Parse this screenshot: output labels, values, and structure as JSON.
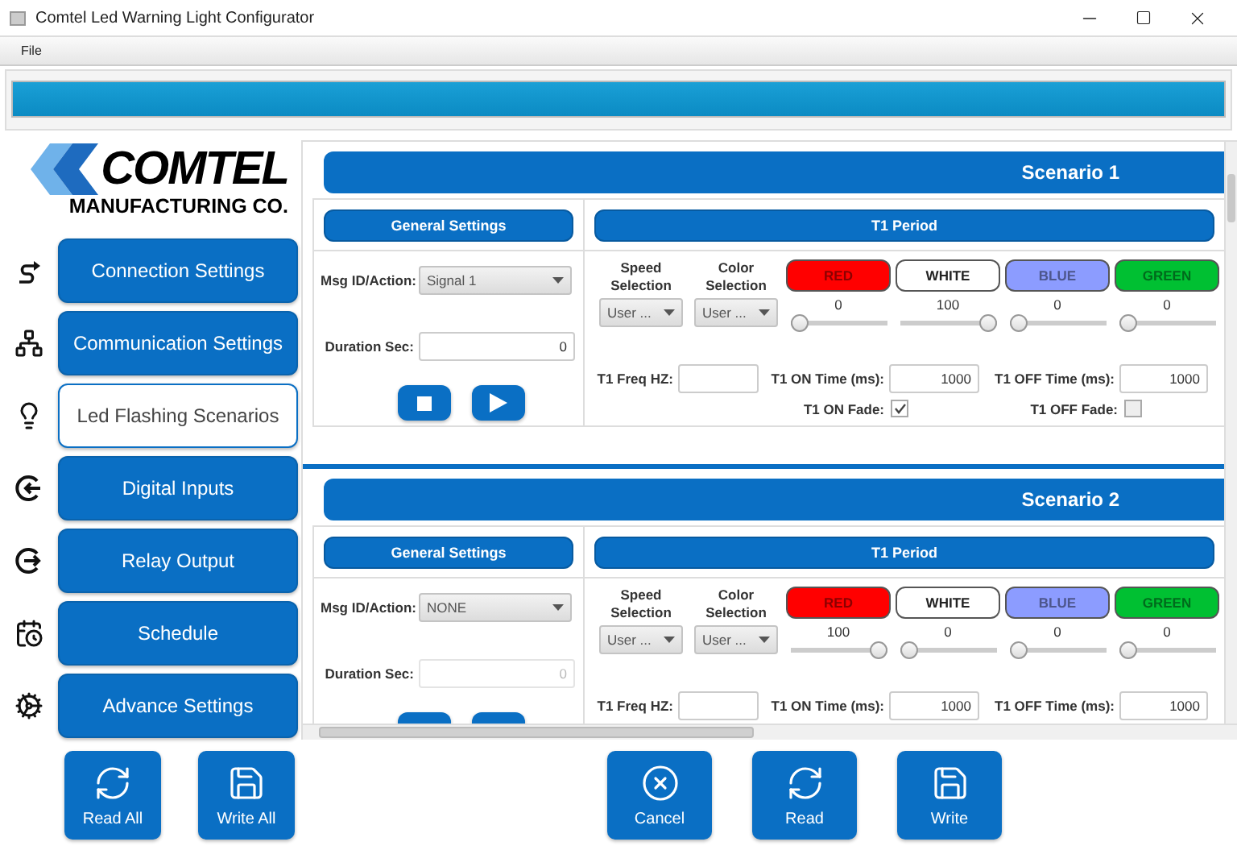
{
  "window": {
    "title": "Comtel Led Warning Light Configurator"
  },
  "menu": [
    "File"
  ],
  "progress": {
    "level": 1
  },
  "logo": {
    "name": "COMTEL",
    "tagline": "MANUFACTURING CO."
  },
  "sidebar": {
    "items": [
      {
        "label": "Connection Settings",
        "selected": false
      },
      {
        "label": "Communication Settings",
        "selected": false
      },
      {
        "label": "Led Flashing Scenarios",
        "selected": true
      },
      {
        "label": "Digital Inputs",
        "selected": false
      },
      {
        "label": "Relay Output",
        "selected": false
      },
      {
        "label": "Schedule",
        "selected": false
      },
      {
        "label": "Advance Settings",
        "selected": false
      }
    ]
  },
  "scenarios": [
    {
      "title": "Scenario 1",
      "general": {
        "header": "General Settings",
        "msg_label": "Msg ID/Action:",
        "msg_value": "Signal 1",
        "duration_label": "Duration Sec:",
        "duration_value": "0",
        "duration_disabled": false
      },
      "period": {
        "header": "T1 Period",
        "speed_label": "Speed Selection",
        "speed_value": "User ...",
        "color_label": "Color Selection",
        "color_value": "User ...",
        "channels": [
          {
            "label": "RED",
            "color": "#ff0000",
            "reading": "0",
            "level": 0
          },
          {
            "label": "WHITE",
            "color": "#ffffff",
            "reading": "100",
            "level": 1
          },
          {
            "label": "BLUE",
            "color": "#8c9cff",
            "reading": "0",
            "level": 0
          },
          {
            "label": "GREEN",
            "color": "#00c032",
            "reading": "0",
            "level": 0
          }
        ],
        "freq_label": "T1 Freq HZ:",
        "on_label": "T1 ON Time (ms):",
        "on_value": "1000",
        "off_label": "T1 OFF Time (ms):",
        "off_value": "1000",
        "fades": [
          {
            "label": "T1 ON Fade:",
            "checked": true
          },
          {
            "label": "T1 OFF Fade:",
            "checked": false
          }
        ]
      }
    },
    {
      "title": "Scenario 2",
      "general": {
        "header": "General Settings",
        "msg_label": "Msg ID/Action:",
        "msg_value": "NONE",
        "duration_label": "Duration Sec:",
        "duration_value": "0",
        "duration_disabled": true
      },
      "period": {
        "header": "T1 Period",
        "speed_label": "Speed Selection",
        "speed_value": "User ...",
        "color_label": "Color Selection",
        "color_value": "User ...",
        "channels": [
          {
            "label": "RED",
            "color": "#ff0000",
            "reading": "100",
            "level": 1
          },
          {
            "label": "WHITE",
            "color": "#ffffff",
            "reading": "0",
            "level": 0
          },
          {
            "label": "BLUE",
            "color": "#8c9cff",
            "reading": "0",
            "level": 0
          },
          {
            "label": "GREEN",
            "color": "#00c032",
            "reading": "0",
            "level": 0
          }
        ],
        "freq_label": "T1 Freq HZ:",
        "on_label": "T1 ON Time (ms):",
        "on_value": "1000",
        "off_label": "T1 OFF Time (ms):",
        "off_value": "1000"
      }
    }
  ],
  "bottom_left": [
    {
      "label": "Read All"
    },
    {
      "label": "Write All"
    }
  ],
  "bottom_right": [
    {
      "label": "Cancel"
    },
    {
      "label": "Read"
    },
    {
      "label": "Write"
    }
  ]
}
